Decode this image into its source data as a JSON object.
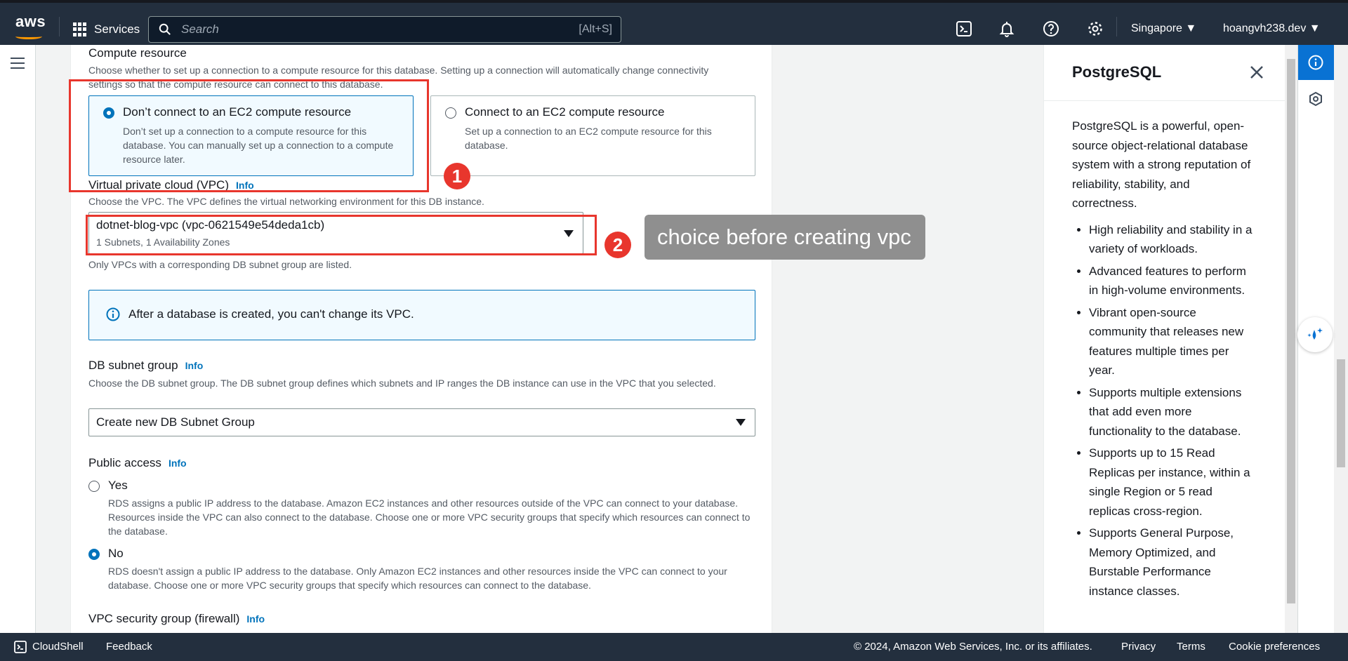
{
  "topbar": {
    "logo": "aws",
    "services_label": "Services",
    "search_placeholder": "Search",
    "search_shortcut": "[Alt+S]",
    "region": "Singapore",
    "user": "hoangvh238.dev",
    "icons": [
      "cloudshell-icon",
      "bell-icon",
      "help-icon",
      "gear-icon"
    ]
  },
  "compute": {
    "title": "Compute resource",
    "desc": "Choose whether to set up a connection to a compute resource for this database. Setting up a connection will automatically change connectivity settings so that the compute resource can connect to this database.",
    "options": [
      {
        "label": "Don’t connect to an EC2 compute resource",
        "desc": "Don’t set up a connection to a compute resource for this database. You can manually set up a connection to a compute resource later.",
        "selected": true
      },
      {
        "label": "Connect to an EC2 compute resource",
        "desc": "Set up a connection to an EC2 compute resource for this database.",
        "selected": false
      }
    ]
  },
  "vpc": {
    "title": "Virtual private cloud (VPC)",
    "info": "Info",
    "desc": "Choose the VPC. The VPC defines the virtual networking environment for this DB instance.",
    "value": "dotnet-blog-vpc (vpc-0621549e54deda1cb)",
    "subvalue": "1 Subnets, 1 Availability Zones",
    "hint": "Only VPCs with a corresponding DB subnet group are listed.",
    "alert": "After a database is created, you can't change its VPC."
  },
  "subnet": {
    "title": "DB subnet group",
    "info": "Info",
    "desc": "Choose the DB subnet group. The DB subnet group defines which subnets and IP ranges the DB instance can use in the VPC that you selected.",
    "value": "Create new DB Subnet Group"
  },
  "public_access": {
    "title": "Public access",
    "info": "Info",
    "options": [
      {
        "label": "Yes",
        "desc": "RDS assigns a public IP address to the database. Amazon EC2 instances and other resources outside of the VPC can connect to your database. Resources inside the VPC can also connect to the database. Choose one or more VPC security groups that specify which resources can connect to the database.",
        "selected": false
      },
      {
        "label": "No",
        "desc": "RDS doesn't assign a public IP address to the database. Only Amazon EC2 instances and other resources inside the VPC can connect to your database. Choose one or more VPC security groups that specify which resources can connect to the database.",
        "selected": true
      }
    ]
  },
  "security_group": {
    "title": "VPC security group (firewall)",
    "info": "Info"
  },
  "annotations": {
    "badge1": "1",
    "badge2": "2",
    "tooltip": "choice before creating vpc"
  },
  "help": {
    "title": "PostgreSQL",
    "intro": "PostgreSQL is a powerful, open-source object-relational database system with a strong reputation of reliability, stability, and correctness.",
    "bullets": [
      "High reliability and stability in a variety of workloads.",
      "Advanced features to perform in high-volume environments.",
      "Vibrant open-source community that releases new features multiple times per year.",
      "Supports multiple extensions that add even more functionality to the database.",
      "Supports up to 15 Read Replicas per instance, within a single Region or 5 read replicas cross-region.",
      "Supports General Purpose, Memory Optimized, and Burstable Performance instance classes."
    ]
  },
  "footer": {
    "cloudshell": "CloudShell",
    "feedback": "Feedback",
    "copyright": "© 2024, Amazon Web Services, Inc. or its affiliates.",
    "privacy": "Privacy",
    "terms": "Terms",
    "cookies": "Cookie preferences"
  },
  "colors": {
    "topbar": "#232f3e",
    "accent": "#0073bb",
    "annotation": "#e8362d"
  }
}
